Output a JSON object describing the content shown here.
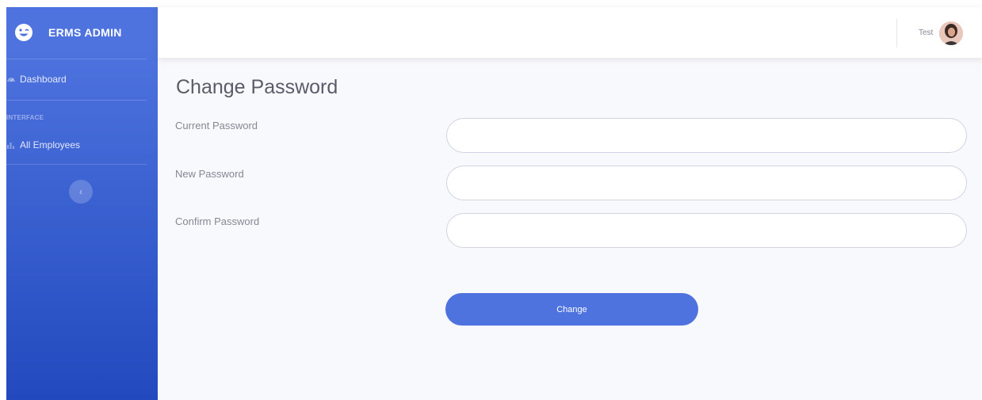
{
  "sidebar": {
    "brand": "ERMS ADMIN",
    "items": [
      {
        "label": "Dashboard",
        "icon": "dashboard-icon"
      },
      {
        "label": "All Employees",
        "icon": "chart-icon"
      }
    ],
    "heading": "INTERFACE",
    "toggle_icon": "chevron-left-icon"
  },
  "topbar": {
    "user_name": "Test"
  },
  "page": {
    "title": "Change Password"
  },
  "form": {
    "fields": [
      {
        "label": "Current Password",
        "value": "",
        "placeholder": ""
      },
      {
        "label": "New Password",
        "value": "",
        "placeholder": ""
      },
      {
        "label": "Confirm Password",
        "value": "",
        "placeholder": ""
      }
    ],
    "submit_label": "Change"
  },
  "colors": {
    "primary": "#4e73df",
    "sidebar_bottom": "#224abe",
    "background": "#f8f9fc",
    "text_muted": "#858796"
  }
}
